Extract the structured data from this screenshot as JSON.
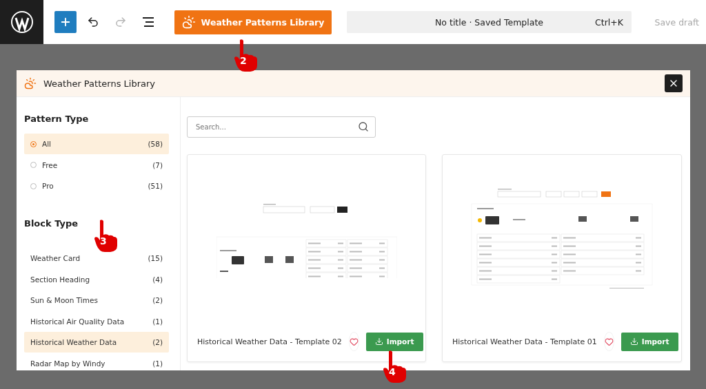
{
  "topbar": {
    "library_button": "Weather Patterns Library",
    "command_bar": {
      "title": "No title · Saved Template",
      "shortcut": "Ctrl+K"
    },
    "redo": {
      "disabled": true
    },
    "save_draft": {
      "label": "Save draft",
      "disabled": true
    }
  },
  "modal": {
    "title": "Weather Patterns Library",
    "search": {
      "placeholder": "Search..."
    },
    "pattern_type": {
      "heading": "Pattern Type",
      "items": [
        {
          "label": "All",
          "count": "(58)",
          "selected": true
        },
        {
          "label": "Free",
          "count": "(7)",
          "selected": false
        },
        {
          "label": "Pro",
          "count": "(51)",
          "selected": false
        }
      ]
    },
    "block_type": {
      "heading": "Block Type",
      "items": [
        {
          "label": "Weather Card",
          "count": "(15)",
          "selected": false
        },
        {
          "label": "Section Heading",
          "count": "(4)",
          "selected": false
        },
        {
          "label": "Sun & Moon Times",
          "count": "(2)",
          "selected": false
        },
        {
          "label": "Historical Air Quality Data",
          "count": "(1)",
          "selected": false
        },
        {
          "label": "Historical Weather Data",
          "count": "(2)",
          "selected": true
        },
        {
          "label": "Radar Map by Windy",
          "count": "(1)",
          "selected": false
        }
      ]
    },
    "templates": [
      {
        "title": "Historical Weather Data - Template 02",
        "kind": "compact",
        "favorite": false,
        "button": "Import"
      },
      {
        "title": "Historical Weather Data - Template 01",
        "kind": "full",
        "favorite": false,
        "button": "Import"
      }
    ]
  },
  "annotations": [
    {
      "label": "2"
    },
    {
      "label": "3"
    },
    {
      "label": "4"
    }
  ]
}
